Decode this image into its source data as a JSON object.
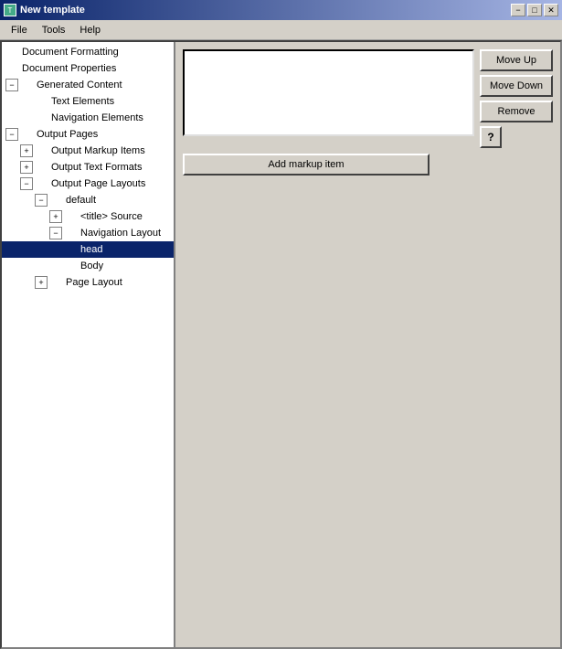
{
  "titleBar": {
    "title": "New template",
    "minBtn": "−",
    "maxBtn": "□",
    "closeBtn": "✕"
  },
  "menuBar": {
    "items": [
      "File",
      "Tools",
      "Help"
    ]
  },
  "tree": {
    "items": [
      {
        "id": "doc-formatting",
        "label": "Document Formatting",
        "indent": 1,
        "expander": null,
        "selected": false
      },
      {
        "id": "doc-properties",
        "label": "Document Properties",
        "indent": 1,
        "expander": null,
        "selected": false
      },
      {
        "id": "generated-content",
        "label": "Generated Content",
        "indent": 1,
        "expander": "−",
        "selected": false
      },
      {
        "id": "text-elements",
        "label": "Text Elements",
        "indent": 3,
        "expander": null,
        "selected": false
      },
      {
        "id": "nav-elements",
        "label": "Navigation Elements",
        "indent": 3,
        "expander": null,
        "selected": false
      },
      {
        "id": "output-pages",
        "label": "Output Pages",
        "indent": 1,
        "expander": "−",
        "selected": false
      },
      {
        "id": "output-markup-items",
        "label": "Output Markup Items",
        "indent": 2,
        "expander": "+",
        "selected": false
      },
      {
        "id": "output-text-formats",
        "label": "Output Text Formats",
        "indent": 2,
        "expander": "+",
        "selected": false
      },
      {
        "id": "output-page-layouts",
        "label": "Output Page Layouts",
        "indent": 2,
        "expander": "−",
        "selected": false
      },
      {
        "id": "default",
        "label": "default",
        "indent": 3,
        "expander": "−",
        "selected": false
      },
      {
        "id": "title-source",
        "label": "<title> Source",
        "indent": 4,
        "expander": "+",
        "selected": false
      },
      {
        "id": "nav-layout",
        "label": "Navigation Layout",
        "indent": 4,
        "expander": "−",
        "selected": false
      },
      {
        "id": "head",
        "label": "head",
        "indent": 5,
        "expander": null,
        "selected": true
      },
      {
        "id": "body",
        "label": "Body",
        "indent": 5,
        "expander": null,
        "selected": false
      },
      {
        "id": "page-layout",
        "label": "Page Layout",
        "indent": 3,
        "expander": "+",
        "selected": false
      }
    ]
  },
  "buttons": {
    "moveUp": "Move Up",
    "moveDown": "Move Down",
    "remove": "Remove",
    "addMarkupItem": "Add markup item",
    "help": "?"
  }
}
